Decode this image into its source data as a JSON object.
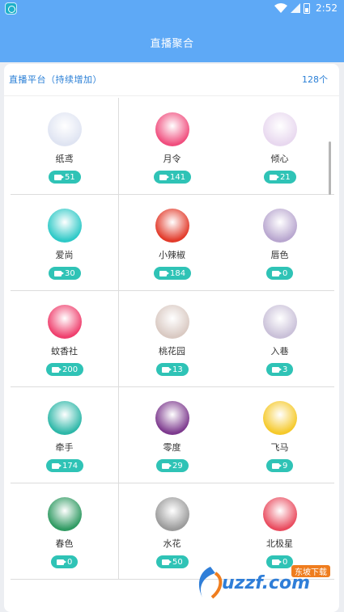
{
  "status": {
    "time": "2:52"
  },
  "header": {
    "title": "直播聚合"
  },
  "section": {
    "title": "直播平台（持续增加）",
    "count": "128个"
  },
  "platforms": [
    {
      "name": "纸鸢",
      "count": "51",
      "icon": "paper-kite-icon",
      "color": "#dfe4f2"
    },
    {
      "name": "月令",
      "count": "141",
      "icon": "yueling-play-icon",
      "color": "#f04d7d"
    },
    {
      "name": "倾心",
      "count": "21",
      "icon": "qingxin-avatar-icon",
      "color": "#e8d8ef"
    },
    {
      "name": "爱尚",
      "count": "30",
      "icon": "aishang-eye-icon",
      "color": "#2ec9c7"
    },
    {
      "name": "小辣椒",
      "count": "184",
      "icon": "chili-pepper-icon",
      "color": "#e23a2a"
    },
    {
      "name": "唇色",
      "count": "0",
      "icon": "chunse-avatar-icon",
      "color": "#b8a6cf"
    },
    {
      "name": "蚊香社",
      "count": "200",
      "icon": "wenxiangshe-rabbit-icon",
      "color": "#ef3f6d"
    },
    {
      "name": "桃花园",
      "count": "13",
      "icon": "taohuayuan-avatar-icon",
      "color": "#d9c9c2"
    },
    {
      "name": "入巷",
      "count": "3",
      "icon": "ruxiang-avatar-icon",
      "color": "#c9c0d8"
    },
    {
      "name": "牵手",
      "count": "174",
      "icon": "yingke-owl-icon",
      "color": "#2db7a8"
    },
    {
      "name": "零度",
      "count": "29",
      "icon": "lingdu-logo-icon",
      "color": "#7d3a8e"
    },
    {
      "name": "飞马",
      "count": "9",
      "icon": "feima-smiley-icon",
      "color": "#f5c92a"
    },
    {
      "name": "春色",
      "count": "0",
      "icon": "chunse-starbucks-icon",
      "color": "#2f9a62"
    },
    {
      "name": "水花",
      "count": "50",
      "icon": "shuihua-avatar-icon",
      "color": "#9a9a9a"
    },
    {
      "name": "北极星",
      "count": "0",
      "icon": "beijixing-anime-icon",
      "color": "#e94b5e"
    }
  ],
  "watermark": {
    "brand": "uzzf.com",
    "tag": "东坡下载"
  }
}
